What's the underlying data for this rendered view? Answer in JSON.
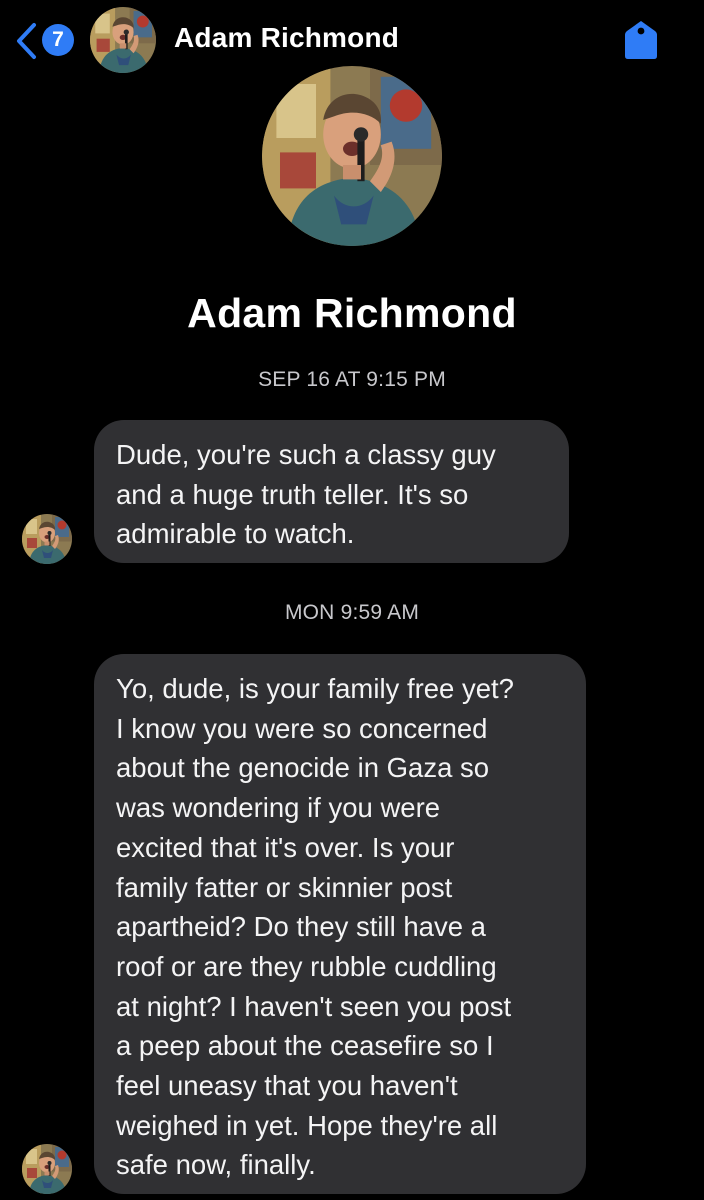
{
  "header": {
    "unread_count": "7",
    "contact_name": "Adam Richmond"
  },
  "profile": {
    "name": "Adam Richmond"
  },
  "messages": [
    {
      "timestamp": "SEP 16 AT 9:15 PM",
      "lines": [
        "Dude, you're such a classy guy",
        "and a huge truth teller. It's so",
        "admirable to watch."
      ]
    },
    {
      "timestamp": "MON 9:59 AM",
      "lines": [
        "Yo, dude, is your family free yet?",
        "I know you were so concerned",
        "about the genocide in Gaza so",
        "was wondering if you were",
        "excited that it's over. Is your",
        "family fatter or skinnier post",
        "apartheid? Do they still have a",
        "roof or are they rubble cuddling",
        "at night? I haven't seen you post",
        "a peep about the ceasefire so I",
        "feel uneasy that you haven't",
        "weighed in yet. Hope they're all",
        "safe now, finally."
      ]
    }
  ],
  "colors": {
    "accent": "#2f7cf6",
    "bubble": "#303033",
    "background": "#000000",
    "timestamp_text": "#c8c8cc"
  },
  "icons": {
    "back": "chevron-left-icon",
    "details": "tag-icon"
  }
}
